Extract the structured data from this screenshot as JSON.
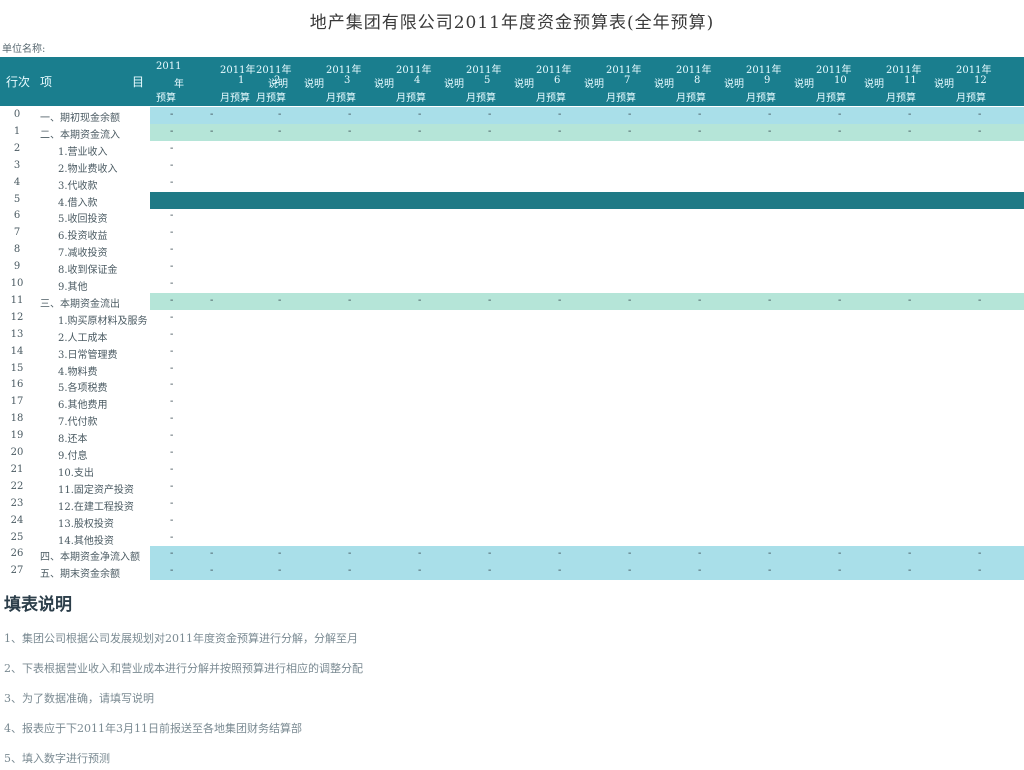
{
  "title": "地产集团有限公司2011年度资金预算表(全年预算)",
  "unit_label": "单位名称:",
  "header": {
    "row_no": "行次",
    "item_left": "项",
    "item_right": "目",
    "months": [
      {
        "a": "2011",
        "b": "年",
        "c": "预算",
        "note": ""
      },
      {
        "a": "2011年",
        "b": "1",
        "c": "月预算",
        "note": "说明"
      },
      {
        "a": "2011年",
        "b": "2",
        "c": "月预算",
        "note": "说明"
      },
      {
        "a": "2011年",
        "b": "3",
        "c": "月预算",
        "note": "说明"
      },
      {
        "a": "2011年",
        "b": "4",
        "c": "月预算",
        "note": "说明"
      },
      {
        "a": "2011年",
        "b": "5",
        "c": "月预算",
        "note": "说明"
      },
      {
        "a": "2011年",
        "b": "6",
        "c": "月预算",
        "note": "说明"
      },
      {
        "a": "2011年",
        "b": "7",
        "c": "月预算",
        "note": "说明"
      },
      {
        "a": "2011年",
        "b": "8",
        "c": "月预算",
        "note": "说明"
      },
      {
        "a": "2011年",
        "b": "9",
        "c": "月预算",
        "note": "说明"
      },
      {
        "a": "2011年",
        "b": "10",
        "c": "月预算",
        "note": "说明"
      },
      {
        "a": "2011年",
        "b": "11",
        "c": "月预算",
        "note": "说明"
      },
      {
        "a": "2011年",
        "b": "12",
        "c": "月预算",
        "note": ""
      }
    ]
  },
  "dash": "-",
  "rows": [
    {
      "n": "0",
      "label": "一、期初现金余额",
      "style": "lb",
      "dashes": "all"
    },
    {
      "n": "1",
      "label": "二、本期资金流入",
      "style": "lg",
      "dashes": "all"
    },
    {
      "n": "2",
      "label": "1.营业收入",
      "style": "",
      "dashes": "first"
    },
    {
      "n": "3",
      "label": "2.物业费收入",
      "style": "",
      "dashes": "first"
    },
    {
      "n": "4",
      "label": "3.代收款",
      "style": "",
      "dashes": "first"
    },
    {
      "n": "5",
      "label": "4.借入款",
      "style": "dk",
      "dashes": "none"
    },
    {
      "n": "6",
      "label": "5.收回投资",
      "style": "",
      "dashes": "first"
    },
    {
      "n": "7",
      "label": "6.投资收益",
      "style": "",
      "dashes": "first"
    },
    {
      "n": "8",
      "label": "7.减收投资",
      "style": "",
      "dashes": "first"
    },
    {
      "n": "9",
      "label": "8.收到保证金",
      "style": "",
      "dashes": "first"
    },
    {
      "n": "10",
      "label": "9.其他",
      "style": "",
      "dashes": "first"
    },
    {
      "n": "11",
      "label": "三、本期资金流出",
      "style": "lg",
      "dashes": "all"
    },
    {
      "n": "12",
      "label": "1.购买原材料及服务",
      "style": "",
      "dashes": "first"
    },
    {
      "n": "13",
      "label": "2.人工成本",
      "style": "",
      "dashes": "first"
    },
    {
      "n": "14",
      "label": "3.日常管理费",
      "style": "",
      "dashes": "first"
    },
    {
      "n": "15",
      "label": "4.物料费",
      "style": "",
      "dashes": "first"
    },
    {
      "n": "16",
      "label": "5.各项税费",
      "style": "",
      "dashes": "first"
    },
    {
      "n": "17",
      "label": "6.其他费用",
      "style": "",
      "dashes": "first"
    },
    {
      "n": "18",
      "label": "7.代付款",
      "style": "",
      "dashes": "first"
    },
    {
      "n": "19",
      "label": "8.还本",
      "style": "",
      "dashes": "first"
    },
    {
      "n": "20",
      "label": "9.付息",
      "style": "",
      "dashes": "first"
    },
    {
      "n": "21",
      "label": "10.支出",
      "style": "",
      "dashes": "first"
    },
    {
      "n": "22",
      "label": "11.固定资产投资",
      "style": "",
      "dashes": "first"
    },
    {
      "n": "23",
      "label": "12.在建工程投资",
      "style": "",
      "dashes": "first"
    },
    {
      "n": "24",
      "label": "13.股权投资",
      "style": "",
      "dashes": "first"
    },
    {
      "n": "25",
      "label": "14.其他投资",
      "style": "",
      "dashes": "first"
    },
    {
      "n": "26",
      "label": "四、本期资金净流入额",
      "style": "lb",
      "dashes": "all"
    },
    {
      "n": "27",
      "label": "五、期末资金余额",
      "style": "lb",
      "dashes": "all"
    }
  ],
  "notes_title": "填表说明",
  "notes": [
    "1、集团公司根据公司发展规划对2011年度资金预算进行分解，分解至月",
    "2、下表根据营业收入和营业成本进行分解并按照预算进行相应的调整分配",
    "3、为了数据准确，请填写说明",
    "4、报表应于下2011年3月11日前报送至各地集团财务结算部",
    "5、填入数字进行预测"
  ]
}
